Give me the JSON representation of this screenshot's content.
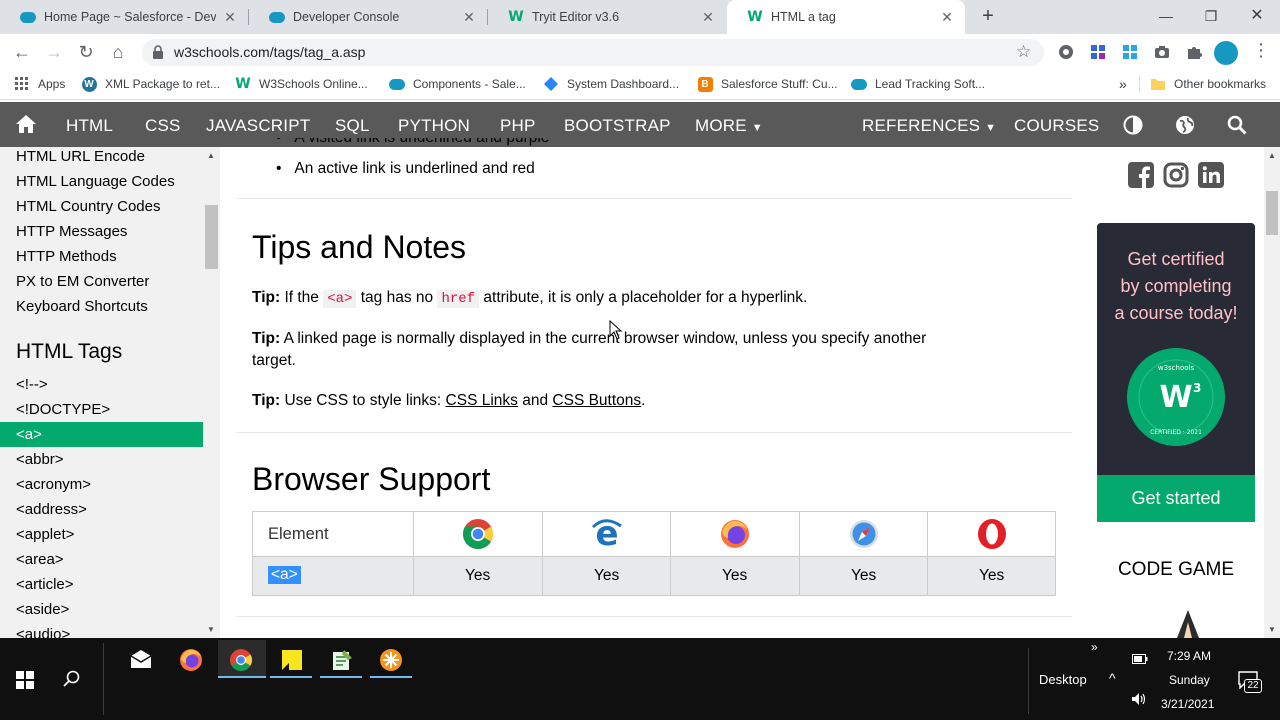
{
  "browser": {
    "tabs": [
      {
        "title": "Home Page ~ Salesforce - Develo",
        "icon": "salesforce-cloud-icon"
      },
      {
        "title": "Developer Console",
        "icon": "salesforce-cloud-icon"
      },
      {
        "title": "Tryit Editor v3.6",
        "icon": "w3schools-icon"
      },
      {
        "title": "HTML a tag",
        "icon": "w3schools-icon",
        "active": true
      }
    ],
    "url": "w3schools.com/tags/tag_a.asp",
    "bookmarks": [
      {
        "label": "Apps",
        "icon": "apps-grid-icon"
      },
      {
        "label": "XML Package to ret...",
        "icon": "wordpress-icon"
      },
      {
        "label": "W3Schools Online...",
        "icon": "w3schools-icon"
      },
      {
        "label": "Components - Sale...",
        "icon": "salesforce-cloud-icon"
      },
      {
        "label": "System Dashboard...",
        "icon": "jira-icon"
      },
      {
        "label": "Salesforce Stuff: Cu...",
        "icon": "blogger-icon"
      },
      {
        "label": "Lead Tracking Soft...",
        "icon": "salesforce-cloud-icon"
      }
    ],
    "bookmarks_more": "»",
    "other_bookmarks": "Other bookmarks"
  },
  "w3nav": {
    "items": [
      "HTML",
      "CSS",
      "JAVASCRIPT",
      "SQL",
      "PYTHON",
      "PHP",
      "BOOTSTRAP",
      "MORE"
    ],
    "right_items": [
      "REFERENCES",
      "COURSES"
    ]
  },
  "sidebar": {
    "links_top": [
      "HTML URL Encode",
      "HTML Language Codes",
      "HTML Country Codes",
      "HTTP Messages",
      "HTTP Methods",
      "PX to EM Converter",
      "Keyboard Shortcuts"
    ],
    "heading": "HTML Tags",
    "tags": [
      "<!-->",
      "<!DOCTYPE>",
      "<a>",
      "<abbr>",
      "<acronym>",
      "<address>",
      "<applet>",
      "<area>",
      "<article>",
      "<aside>",
      "<audio>"
    ],
    "active_tag": "<a>"
  },
  "main": {
    "bullet_partial": "A visited link is underlined and purple",
    "bullet_active": "An active link is underlined and red",
    "tips_heading": "Tips and Notes",
    "tip_label": "Tip:",
    "tip1_pre": "If the",
    "tip1_code1": "<a>",
    "tip1_mid": "tag has no",
    "tip1_code2": "href",
    "tip1_post": "attribute, it is only a placeholder for a hyperlink.",
    "tip2_line1": "A linked page is normally displayed in the current browser window, unless you specify another",
    "tip2_line2": "target.",
    "tip3_pre": "Use CSS to style links:",
    "tip3_link1": "CSS Links",
    "tip3_and": "and",
    "tip3_link2": "CSS Buttons",
    "tip3_end": ".",
    "browser_heading": "Browser Support",
    "table": {
      "header": "Element",
      "browsers": [
        "chrome-icon",
        "edge-icon",
        "firefox-icon",
        "safari-icon",
        "opera-icon"
      ],
      "row_element": "<a>",
      "row_values": [
        "Yes",
        "Yes",
        "Yes",
        "Yes",
        "Yes"
      ]
    }
  },
  "right": {
    "promo_lines": [
      "Get certified",
      "by completing",
      "a course today!"
    ],
    "badge_text": "w3schools",
    "badge_ring": "CERTIFIED · 2021",
    "cta": "Get started",
    "code_game": "CODE GAME"
  },
  "taskbar": {
    "desktop_label": "Desktop",
    "time": "7:29 AM",
    "day": "Sunday",
    "date": "3/21/2021",
    "notification_count": "22",
    "chevrons": "»"
  },
  "colors": {
    "w3_green": "#04aa6d",
    "nav_bg": "#595959",
    "promo_bg": "#282a35",
    "promo_text": "#ffc0c7",
    "code_red": "#dc143c"
  }
}
